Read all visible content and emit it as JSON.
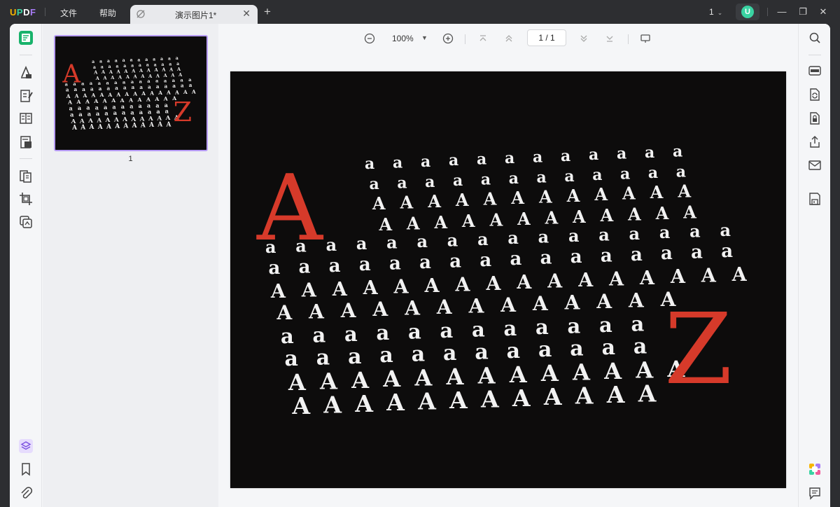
{
  "app": {
    "logo": "UPDF",
    "menu": [
      "文件",
      "帮助"
    ],
    "tab_title": "演示图片1*",
    "page_selector": "1",
    "avatar_letter": "U"
  },
  "thumbnails": [
    {
      "page_number": "1"
    }
  ],
  "toolbar": {
    "zoom": "100%",
    "page_indicator": "1  /  1"
  },
  "image_content": {
    "big_left_letter": "A",
    "big_right_letter": "Z",
    "rows": [
      {
        "text": "a a a a a a a a a a a a"
      },
      {
        "text": "a a a a a a a a a a a a"
      },
      {
        "text": "A A A A A A A A A A A A"
      },
      {
        "text": "A A A A A A A A A A A A"
      },
      {
        "text": "a a a a a a a a a a a a a a a a"
      },
      {
        "text": "a a a a a a a a a a a a a a a a"
      },
      {
        "text": "A A A A A A A A A A A A A A A A"
      },
      {
        "text": "A A A A A A A A A A A A A"
      },
      {
        "text": "a a a a a a a a a a a a"
      },
      {
        "text": "a a a a a a a a a a a a"
      },
      {
        "text": "A A A A A A A A A A A A A"
      },
      {
        "text": "A A A A A A A A A A A A"
      }
    ]
  },
  "colors": {
    "accent": "#b79cf5",
    "brand_green": "#3ad3a2",
    "letter_red": "#d63a2a",
    "letter_white": "#f2f2f2",
    "image_bg": "#0d0c0c"
  },
  "icons": {
    "left_rail": [
      "reader-icon",
      "comment-icon",
      "edit-icon",
      "form-icon",
      "pages-icon",
      "organize-icon",
      "crop-icon",
      "tools-icon",
      "layers-icon",
      "bookmark-icon",
      "attachment-icon"
    ],
    "right_rail": [
      "search-icon",
      "ocr-icon",
      "convert-icon",
      "protect-icon",
      "share-icon",
      "email-icon",
      "save-icon",
      "ai-icon",
      "chat-icon"
    ]
  }
}
